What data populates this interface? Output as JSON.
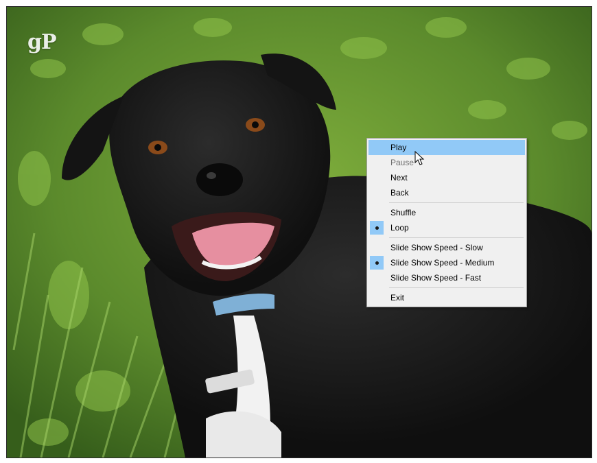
{
  "watermark": "gP",
  "menu": {
    "items": [
      {
        "label": "Play",
        "state": "hover"
      },
      {
        "label": "Pause",
        "state": "disabled"
      },
      {
        "label": "Next"
      },
      {
        "label": "Back"
      },
      {
        "separator": true
      },
      {
        "label": "Shuffle"
      },
      {
        "label": "Loop",
        "checked": true
      },
      {
        "separator": true
      },
      {
        "label": "Slide Show Speed - Slow"
      },
      {
        "label": "Slide Show Speed - Medium",
        "checked": true
      },
      {
        "label": "Slide Show Speed - Fast"
      },
      {
        "separator": true
      },
      {
        "label": "Exit"
      }
    ],
    "labels": {
      "play": "Play",
      "pause": "Pause",
      "next": "Next",
      "back": "Back",
      "shuffle": "Shuffle",
      "loop": "Loop",
      "speed_slow": "Slide Show Speed - Slow",
      "speed_medium": "Slide Show Speed - Medium",
      "speed_fast": "Slide Show Speed - Fast",
      "exit": "Exit"
    },
    "colors": {
      "highlight": "#91c9f7",
      "background": "#f0f0f0",
      "disabled_text": "#6d6d6d"
    }
  },
  "icons": {
    "cursor": "arrow-cursor-icon",
    "radio": "radio-dot-icon"
  }
}
